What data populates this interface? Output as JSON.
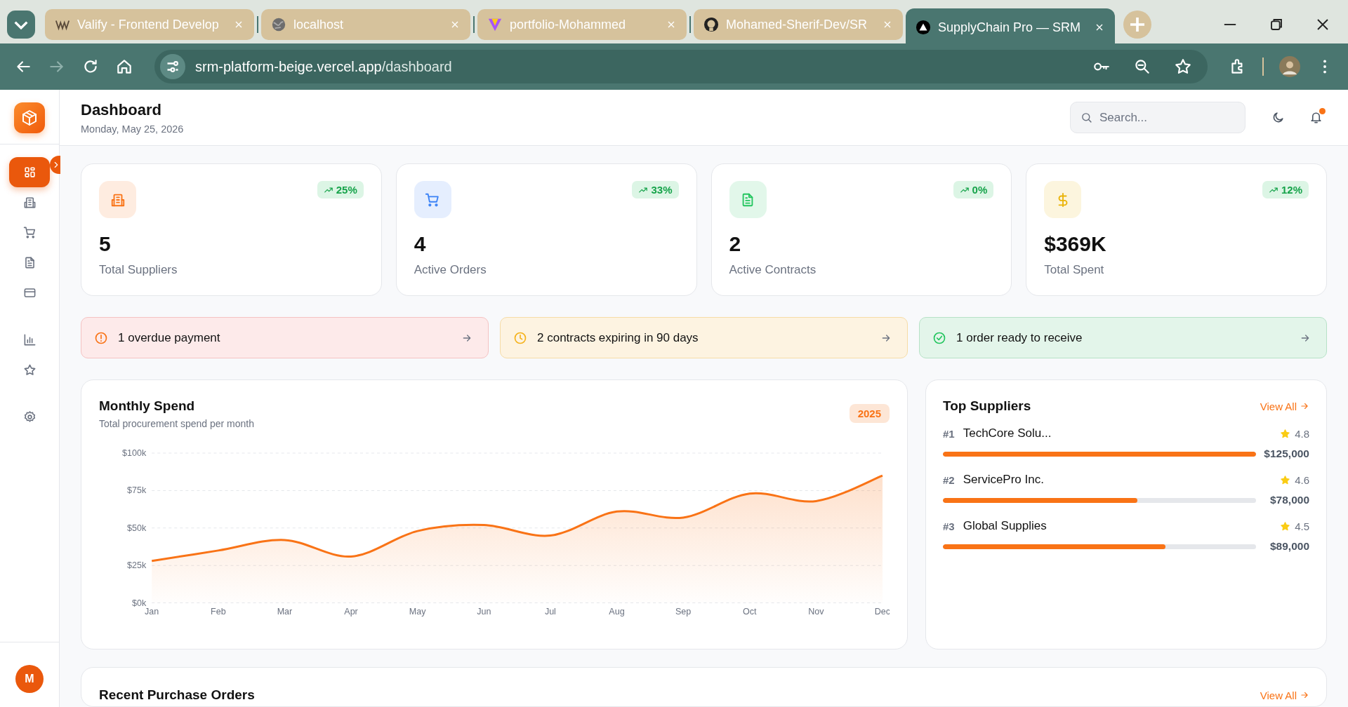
{
  "browser": {
    "tabs": [
      {
        "kind": "logo",
        "title": "Valify - Frontend Develop",
        "selected": false
      },
      {
        "kind": "globe",
        "title": "localhost",
        "selected": false
      },
      {
        "kind": "v-logo",
        "title": "portfolio-Mohammed",
        "selected": false
      },
      {
        "kind": "octocat",
        "title": "Mohamed-Sherif-Dev/SR",
        "selected": false
      },
      {
        "kind": "triangle",
        "title": "SupplyChain Pro — SRM",
        "selected": true
      }
    ],
    "url_host": "srm-platform-beige.vercel.app",
    "url_path": "/dashboard"
  },
  "sidebar": {
    "groups": [
      {
        "items": [
          {
            "kind": "dashboard",
            "selected": true
          },
          {
            "kind": "suppliers",
            "selected": false
          },
          {
            "kind": "orders",
            "selected": false
          },
          {
            "kind": "contracts",
            "selected": false
          },
          {
            "kind": "payments",
            "selected": false
          }
        ]
      },
      {
        "items": [
          {
            "kind": "reports",
            "selected": false
          },
          {
            "kind": "ratings",
            "selected": false
          }
        ]
      },
      {
        "items": [
          {
            "kind": "settings",
            "selected": false
          }
        ]
      }
    ],
    "avatar": "M"
  },
  "header": {
    "title": "Dashboard",
    "date": "Monday, May 25, 2026",
    "search": {
      "placeholder": "Search..."
    },
    "has_notification": true
  },
  "stats": [
    {
      "kind": "suppliers",
      "color": "#f97316",
      "trend": "25%",
      "value": "5",
      "label": "Total Suppliers"
    },
    {
      "kind": "orders",
      "color": "#3b82f6",
      "trend": "33%",
      "value": "4",
      "label": "Active Orders"
    },
    {
      "kind": "contracts",
      "color": "#22c55e",
      "trend": "0%",
      "value": "2",
      "label": "Active Contracts"
    },
    {
      "kind": "spend",
      "color": "#eab308",
      "trend": "12%",
      "value": "$369K",
      "label": "Total Spent"
    }
  ],
  "alerts": [
    {
      "kind": "error",
      "text": "1 overdue payment"
    },
    {
      "kind": "warning",
      "text": "2 contracts expiring in 90 days"
    },
    {
      "kind": "success",
      "text": "1 order ready to receive"
    }
  ],
  "monthly_spend": {
    "title": "Monthly Spend",
    "subtitle": "Total procurement spend per month",
    "year": "2025",
    "chart_data": {
      "type": "area",
      "categories": [
        "Jan",
        "Feb",
        "Mar",
        "Apr",
        "May",
        "Jun",
        "Jul",
        "Aug",
        "Sep",
        "Oct",
        "Nov",
        "Dec"
      ],
      "grid": true,
      "series": [
        {
          "color": "#f97316",
          "values": [
            28000,
            35000,
            42000,
            31000,
            48000,
            52000,
            45000,
            61000,
            57000,
            73000,
            68000,
            85000
          ]
        }
      ],
      "ylim": [
        0,
        100000
      ],
      "yticks": [
        {
          "value": 0,
          "label": "$0k"
        },
        {
          "value": 25000,
          "label": "$25k"
        },
        {
          "value": 50000,
          "label": "$50k"
        },
        {
          "value": 75000,
          "label": "$75k"
        },
        {
          "value": 100000,
          "label": "$100k"
        }
      ]
    }
  },
  "top_suppliers": {
    "title": "Top Suppliers",
    "view_all": "View All",
    "rows": [
      {
        "rank": "#1",
        "name": "TechCore Solu...",
        "rating": "4.8",
        "amount": "$125,000",
        "level": 1.0
      },
      {
        "rank": "#2",
        "name": "ServicePro Inc.",
        "rating": "4.6",
        "amount": "$78,000",
        "level": 0.62
      },
      {
        "rank": "#3",
        "name": "Global Supplies",
        "rating": "4.5",
        "amount": "$89,000",
        "level": 0.71
      }
    ]
  },
  "recent_orders": {
    "title": "Recent Purchase Orders",
    "view_all": "View All"
  }
}
